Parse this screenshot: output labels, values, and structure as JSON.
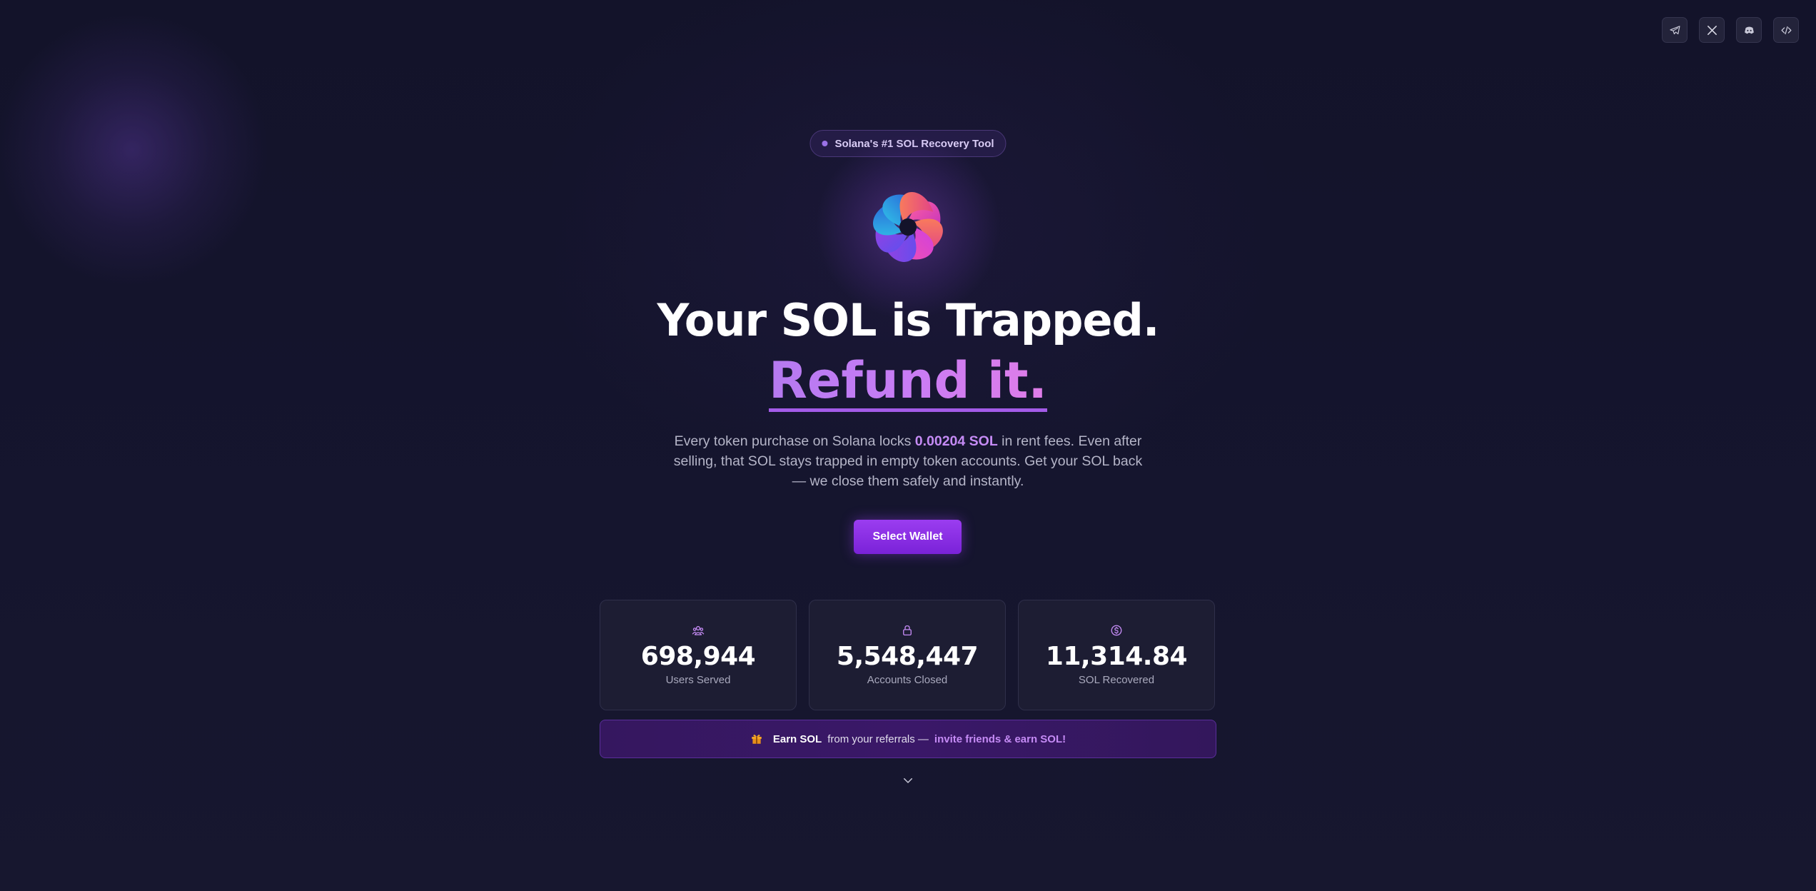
{
  "social": {
    "items": [
      {
        "name": "telegram",
        "icon": "telegram-icon"
      },
      {
        "name": "x",
        "icon": "x-icon"
      },
      {
        "name": "discord",
        "icon": "discord-icon"
      },
      {
        "name": "code",
        "icon": "code-icon"
      }
    ]
  },
  "hero": {
    "badge": "Solana's #1 SOL Recovery Tool",
    "headline": "Your SOL is Trapped.",
    "headline_accent": "Refund it.",
    "description_before": "Every token purchase on Solana locks ",
    "description_highlight": "0.00204 SOL",
    "description_after": " in rent fees. Even after selling, that SOL stays trapped in empty token accounts. Get your SOL back — we close them safely and instantly.",
    "cta": "Select Wallet"
  },
  "stats": [
    {
      "icon": "users-icon",
      "value": "698,944",
      "label": "Users Served"
    },
    {
      "icon": "lock-icon",
      "value": "5,548,447",
      "label": "Accounts Closed"
    },
    {
      "icon": "dollar-coin-icon",
      "value": "11,314.84",
      "label": "SOL Recovered"
    }
  ],
  "referral": {
    "icon": "gift-icon",
    "strong": "Earn SOL",
    "text": "from your referrals —",
    "link": "invite friends & earn SOL!"
  },
  "colors": {
    "background": "#13132a",
    "accent": "#9b3df0",
    "highlight": "#c58bf5"
  }
}
